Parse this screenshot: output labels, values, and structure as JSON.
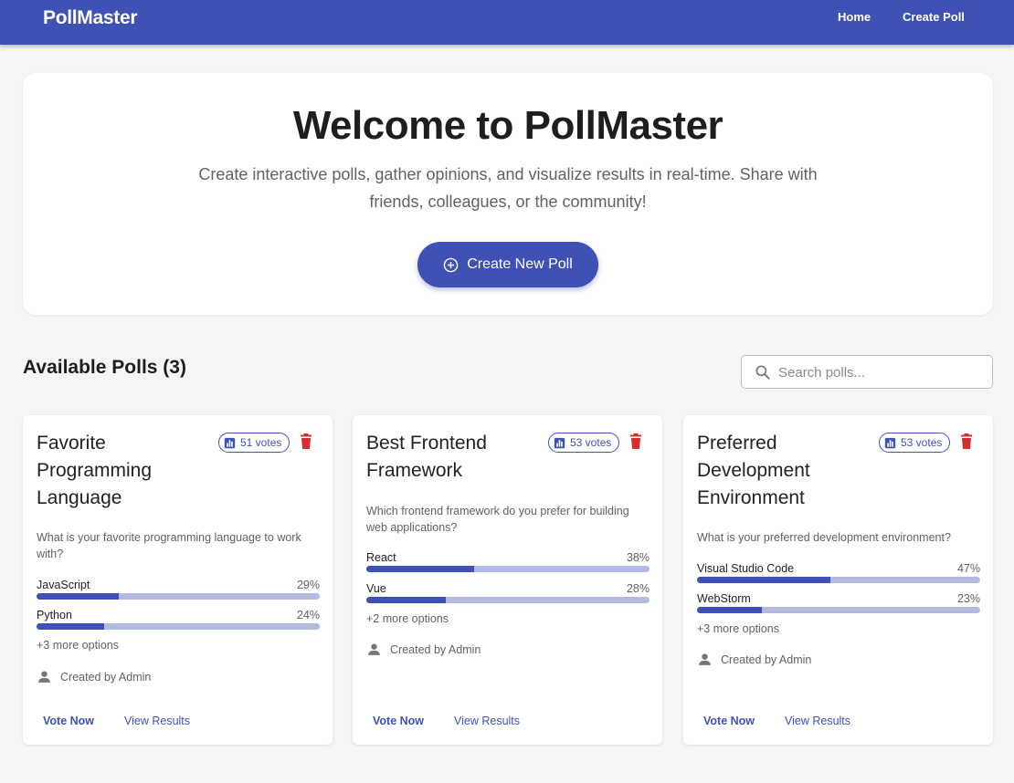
{
  "app": {
    "brand": "PollMaster",
    "nav": {
      "home": "Home",
      "create": "Create Poll"
    }
  },
  "hero": {
    "title": "Welcome to PollMaster",
    "subtitle": "Create interactive polls, gather opinions, and visualize results in real-time. Share with friends, colleagues, or the community!",
    "button": "Create New Poll"
  },
  "polls_section": {
    "title": "Available Polls (3)",
    "search_placeholder": "Search polls..."
  },
  "colors": {
    "primary": "#3f51b5",
    "delete": "#d32f2f",
    "bar_track": "#b3badf"
  },
  "icons": {
    "chip": "bar-chart-icon",
    "delete": "trash-icon",
    "creator": "person-icon",
    "search": "search-icon",
    "create": "plus-circle-icon"
  },
  "polls": [
    {
      "title": "Favorite Programming Language",
      "votes": "51 votes",
      "description": "What is your favorite programming language to work with?",
      "options": [
        {
          "label": "JavaScript",
          "percent": "29%",
          "value": 29
        },
        {
          "label": "Python",
          "percent": "24%",
          "value": 24
        }
      ],
      "more": "+3 more options",
      "creator": "Created by Admin",
      "vote_label": "Vote Now",
      "results_label": "View Results"
    },
    {
      "title": "Best Frontend Framework",
      "votes": "53 votes",
      "description": "Which frontend framework do you prefer for building web applications?",
      "options": [
        {
          "label": "React",
          "percent": "38%",
          "value": 38
        },
        {
          "label": "Vue",
          "percent": "28%",
          "value": 28
        }
      ],
      "more": "+2 more options",
      "creator": "Created by Admin",
      "vote_label": "Vote Now",
      "results_label": "View Results"
    },
    {
      "title": "Preferred Development Environment",
      "votes": "53 votes",
      "description": "What is your preferred development environment?",
      "options": [
        {
          "label": "Visual Studio Code",
          "percent": "47%",
          "value": 47
        },
        {
          "label": "WebStorm",
          "percent": "23%",
          "value": 23
        }
      ],
      "more": "+3 more options",
      "creator": "Created by Admin",
      "vote_label": "Vote Now",
      "results_label": "View Results"
    }
  ]
}
